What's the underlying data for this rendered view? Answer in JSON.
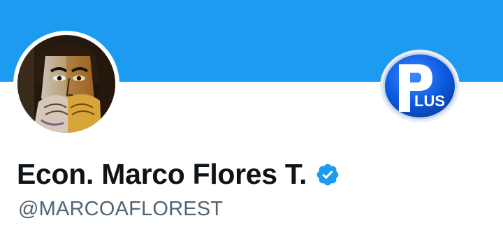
{
  "header": {
    "banner_color": "#1d9bf0"
  },
  "profile": {
    "display_name": "Econ. Marco Flores T.",
    "handle": "@MARCOAFLOREST",
    "verified": true,
    "verified_icon": "verified-badge-icon",
    "verified_color": "#1d9bf0",
    "avatar_icon": "profile-avatar-painting"
  },
  "badge": {
    "icon": "p-plus-logo",
    "letter": "P",
    "label": "LUS",
    "accent": "#0a5bd6"
  },
  "colors": {
    "name": "#0f1419",
    "handle": "#536471"
  }
}
